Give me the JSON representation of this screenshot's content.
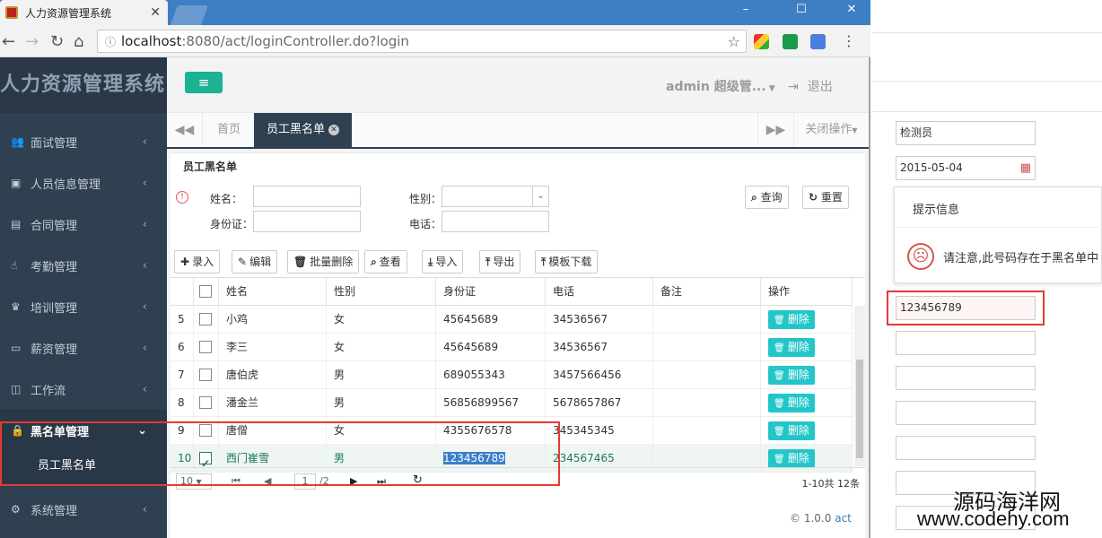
{
  "browser": {
    "tab_title": "人力资源管理系统",
    "url_host": "localhost",
    "url_rest": ":8080/act/loginController.do?login"
  },
  "sidebar": {
    "brand": "人力资源管理系统",
    "items": [
      {
        "label": "面试管理",
        "icon": "users-icon"
      },
      {
        "label": "人员信息管理",
        "icon": "id-card-icon"
      },
      {
        "label": "合同管理",
        "icon": "document-icon"
      },
      {
        "label": "考勤管理",
        "icon": "hand-icon"
      },
      {
        "label": "培训管理",
        "icon": "trophy-icon"
      },
      {
        "label": "薪资管理",
        "icon": "money-icon"
      },
      {
        "label": "工作流",
        "icon": "columns-icon"
      },
      {
        "label": "黑名单管理",
        "icon": "lock-icon"
      },
      {
        "label": "系统管理",
        "icon": "gears-icon"
      }
    ],
    "submenu_label": "员工黑名单"
  },
  "topbar": {
    "toggle_label": "≡",
    "user": "admin 超级管...",
    "logout": "退出"
  },
  "tabs": {
    "home": "首页",
    "active": "员工黑名单",
    "close_ops": "关闭操作"
  },
  "panel": {
    "title": "员工黑名单",
    "search": {
      "name_label": "姓名：",
      "gender_label": "性别：",
      "id_label": "身份证：",
      "phone_label": "电话：",
      "query_label": "查询",
      "reset_label": "重置"
    },
    "toolbar": {
      "add": "录入",
      "edit": "编辑",
      "batch_delete": "批量删除",
      "view": "查看",
      "import": "导入",
      "export": "导出",
      "template": "模板下载"
    },
    "grid": {
      "headers": [
        "姓名",
        "性别",
        "身份证",
        "电话",
        "备注",
        "操作"
      ],
      "delete_label": "删除",
      "rows": [
        {
          "no": "5",
          "name": "小鸡",
          "gender": "女",
          "id": "45645689",
          "phone": "34536567",
          "checked": false
        },
        {
          "no": "6",
          "name": "李三",
          "gender": "女",
          "id": "45645689",
          "phone": "34536567",
          "checked": false
        },
        {
          "no": "7",
          "name": "唐伯虎",
          "gender": "男",
          "id": "689055343",
          "phone": "3457566456",
          "checked": false
        },
        {
          "no": "8",
          "name": "潘金兰",
          "gender": "男",
          "id": "56856899567",
          "phone": "5678657867",
          "checked": false
        },
        {
          "no": "9",
          "name": "唐僧",
          "gender": "女",
          "id": "4355676578",
          "phone": "345345345",
          "checked": false
        },
        {
          "no": "10",
          "name": "西门崔雪",
          "gender": "男",
          "id": "123456789",
          "phone": "234567465",
          "checked": true
        }
      ]
    },
    "pager": {
      "page_size": "10",
      "page_input": "1",
      "page_total": "/2",
      "info": "1-10共 12条"
    },
    "footer": {
      "copyright": "© 1.0.0",
      "version_link": "act"
    }
  },
  "rightwin": {
    "field1": "检测员",
    "field2": "2015-05-04",
    "tip_title": "提示信息",
    "tip_msg": "请注意,此号码存在于黑名单中",
    "highlight_value": "123456789"
  },
  "watermark": {
    "line1": "源码海洋网",
    "line2": "www.codehy.com"
  },
  "colors": {
    "sidebar_bg": "#2f4050",
    "accent_green": "#1ab394",
    "delete_btn": "#23c6c8",
    "annotation_red": "#e53935"
  }
}
